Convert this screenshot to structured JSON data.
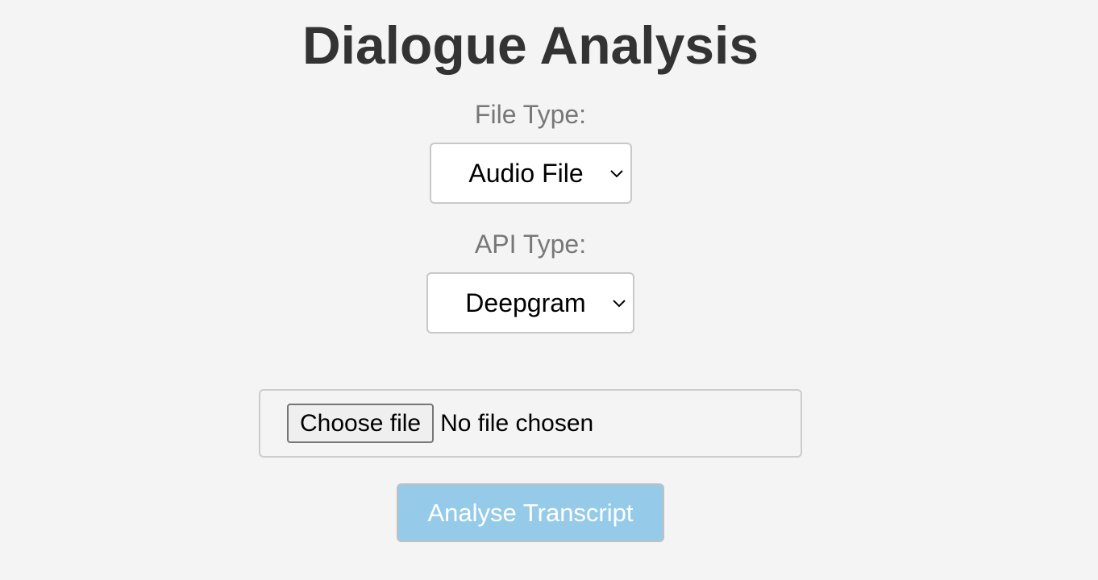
{
  "page": {
    "title": "Dialogue Analysis"
  },
  "file_type": {
    "label": "File Type:",
    "selected": "Audio File"
  },
  "api_type": {
    "label": "API Type:",
    "selected": "Deepgram"
  },
  "file_input": {
    "button_label": "Choose file",
    "status": "No file chosen"
  },
  "submit": {
    "label": "Analyse Transcript",
    "enabled": false
  },
  "colors": {
    "background": "#f4f4f4",
    "title": "#333333",
    "label": "#777777",
    "submit_bg": "#95cbe8",
    "submit_text": "#ffffff"
  },
  "icons": {
    "select_indicator": "chevron-down-icon"
  }
}
